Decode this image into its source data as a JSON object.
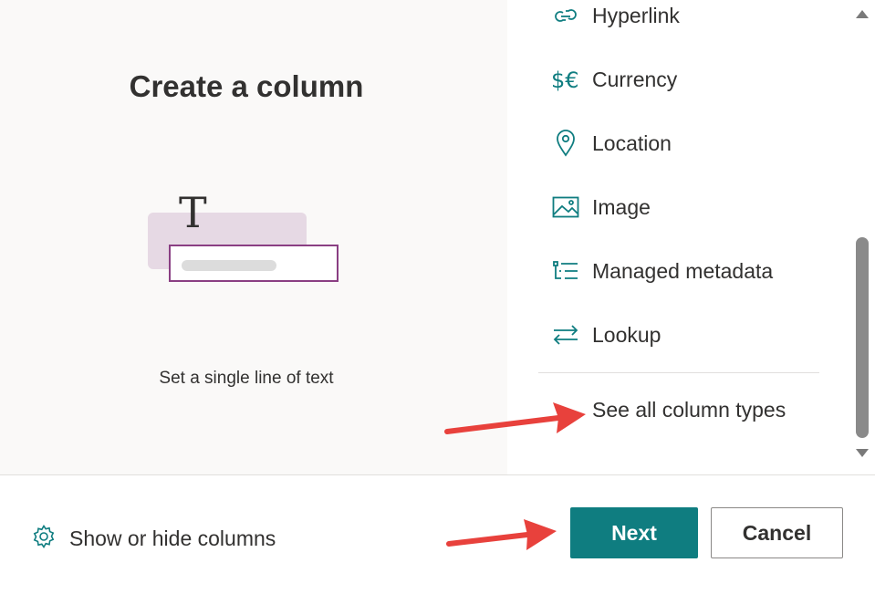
{
  "preview": {
    "title": "Create a column",
    "caption": "Set a single line of text",
    "glyph": "T"
  },
  "column_types": [
    {
      "label": "Hyperlink",
      "icon": "link-icon"
    },
    {
      "label": "Currency",
      "icon": "currency-icon"
    },
    {
      "label": "Location",
      "icon": "location-pin-icon"
    },
    {
      "label": "Image",
      "icon": "image-icon"
    },
    {
      "label": "Managed metadata",
      "icon": "managed-metadata-icon"
    },
    {
      "label": "Lookup",
      "icon": "lookup-arrows-icon"
    }
  ],
  "see_all_label": "See all column types",
  "footer": {
    "show_hide_label": "Show or hide columns",
    "next_label": "Next",
    "cancel_label": "Cancel"
  },
  "colors": {
    "accent": "#0f7d80",
    "annotation_arrow": "#e8413c",
    "illustration_fill": "#e6d9e4",
    "illustration_border": "#8a3f83"
  }
}
